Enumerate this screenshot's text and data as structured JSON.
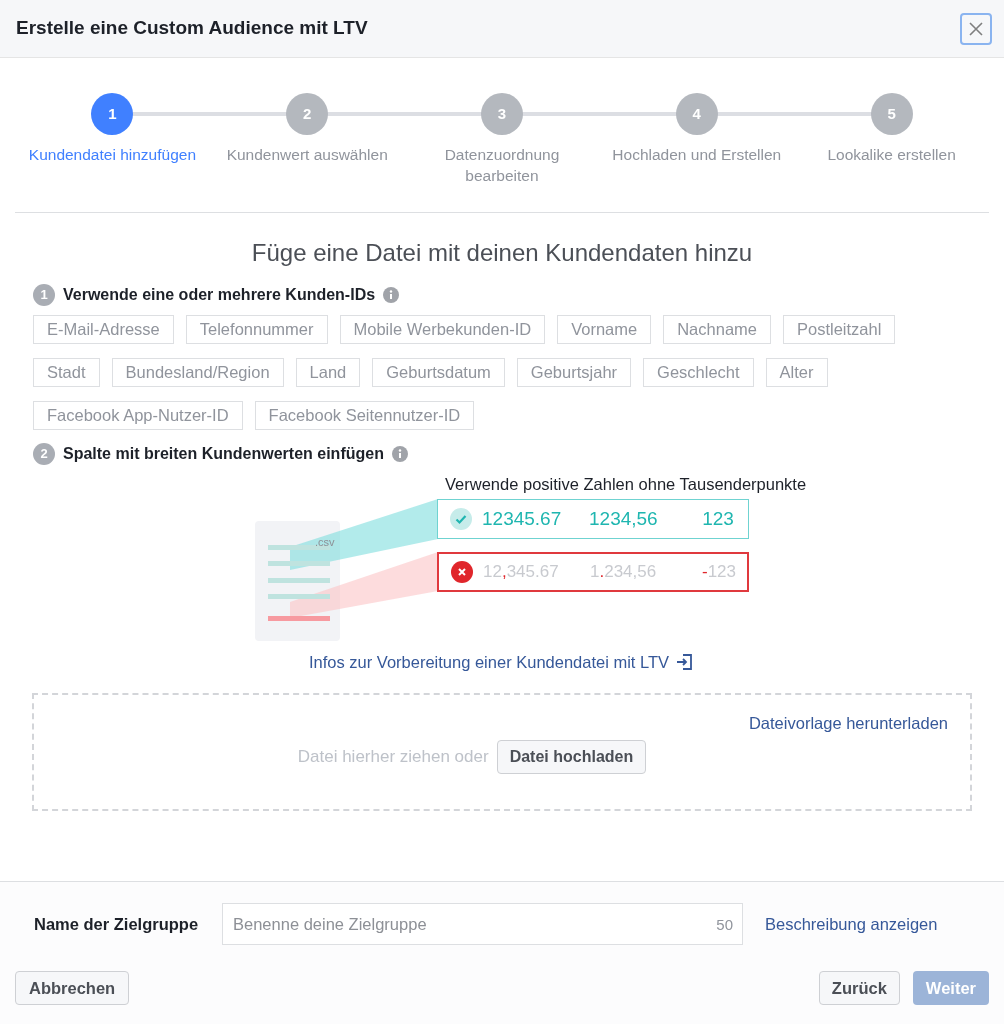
{
  "dialog": {
    "title": "Erstelle eine Custom Audience mit LTV"
  },
  "steps": [
    {
      "number": "1",
      "label": "Kundendatei hinzufügen",
      "selected": true
    },
    {
      "number": "2",
      "label": "Kundenwert auswählen",
      "selected": false
    },
    {
      "number": "3",
      "label": "Datenzuordnung bearbeiten",
      "selected": false
    },
    {
      "number": "4",
      "label": "Hochladen und Erstellen",
      "selected": false
    },
    {
      "number": "5",
      "label": "Lookalike erstellen",
      "selected": false
    }
  ],
  "heading": "Füge eine Datei mit deinen Kundendaten hinzu",
  "section_1": {
    "number": "1",
    "title": "Verwende eine oder mehrere Kunden-IDs",
    "tags": [
      "E-Mail-Adresse",
      "Telefonnummer",
      "Mobile Werbekunden-ID",
      "Vorname",
      "Nachname",
      "Postleitzahl",
      "Stadt",
      "Bundesland/Region",
      "Land",
      "Geburtsdatum",
      "Geburtsjahr",
      "Geschlecht",
      "Alter",
      "Facebook App-Nutzer-ID",
      "Facebook Seitennutzer-ID"
    ]
  },
  "section_2": {
    "number": "2",
    "title": "Spalte mit breiten Kundenwerten einfügen",
    "caption": "Verwende positive Zahlen ohne Tausenderpunkte",
    "file_label": ".csv",
    "examples": [
      {
        "kind": "valid",
        "values": [
          "12345.67",
          "1234,56",
          "123"
        ]
      },
      {
        "kind": "invalid",
        "values": [
          "12**,**345.67",
          "1**.**234,56",
          "**-**123"
        ]
      }
    ],
    "info_link": "Infos zur Vorbereitung einer Kundendatei mit LTV"
  },
  "dropzone": {
    "template_link": "Dateivorlage herunterladen",
    "hint": "Datei hierher ziehen oder",
    "button": "Datei hochladen"
  },
  "name_field": {
    "label": "Name der Zielgruppe",
    "placeholder": "Benenne deine Zielgruppe",
    "counter": "50",
    "description_link": "Beschreibung anzeigen"
  },
  "buttons": {
    "cancel": "Abbrechen",
    "back": "Zurück",
    "next": {
      "label": "Weiter",
      "disabled": true
    }
  }
}
